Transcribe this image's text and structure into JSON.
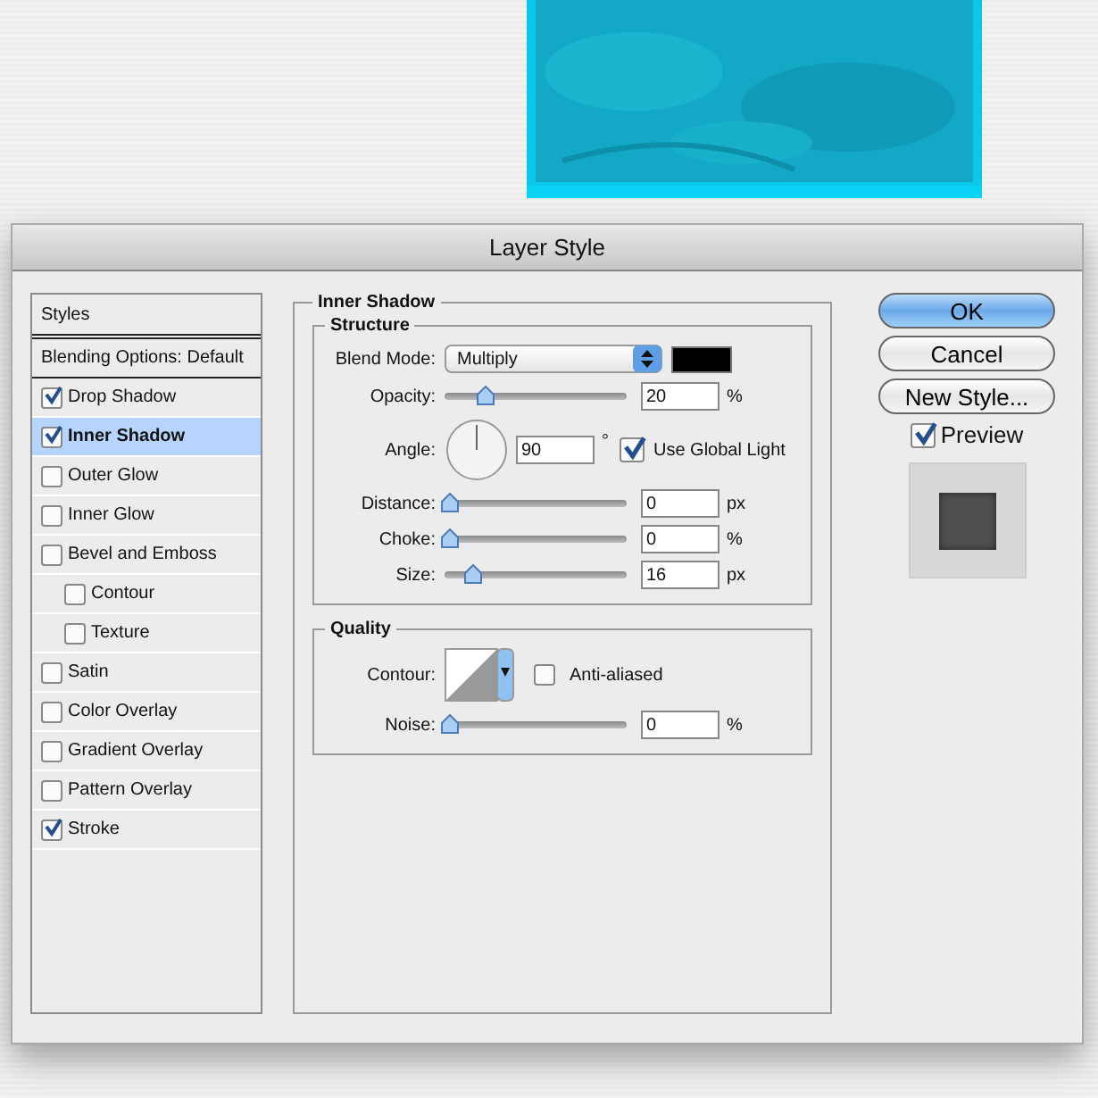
{
  "window": {
    "title": "Layer Style"
  },
  "styles_list": {
    "header": "Styles",
    "items": [
      {
        "kind": "plain",
        "label": "Blending Options: Default",
        "selected": false
      },
      {
        "kind": "check",
        "label": "Drop Shadow",
        "checked": true,
        "selected": false
      },
      {
        "kind": "check",
        "label": "Inner Shadow",
        "checked": true,
        "selected": true
      },
      {
        "kind": "check",
        "label": "Outer Glow",
        "checked": false,
        "selected": false
      },
      {
        "kind": "check",
        "label": "Inner Glow",
        "checked": false,
        "selected": false
      },
      {
        "kind": "check",
        "label": "Bevel and Emboss",
        "checked": false,
        "selected": false,
        "children": [
          {
            "kind": "check",
            "label": "Contour",
            "checked": false,
            "selected": false
          },
          {
            "kind": "check",
            "label": "Texture",
            "checked": false,
            "selected": false
          }
        ]
      },
      {
        "kind": "check",
        "label": "Satin",
        "checked": false,
        "selected": false
      },
      {
        "kind": "check",
        "label": "Color Overlay",
        "checked": false,
        "selected": false
      },
      {
        "kind": "check",
        "label": "Gradient Overlay",
        "checked": false,
        "selected": false
      },
      {
        "kind": "check",
        "label": "Pattern Overlay",
        "checked": false,
        "selected": false
      },
      {
        "kind": "check",
        "label": "Stroke",
        "checked": true,
        "selected": false
      }
    ]
  },
  "inner_shadow": {
    "title": "Inner Shadow",
    "structure": {
      "title": "Structure",
      "rows": [
        {
          "kind": "select",
          "label": "Blend Mode:",
          "value": "Multiply",
          "color": "#000000"
        },
        {
          "kind": "slider",
          "label": "Opacity:",
          "level": 0.2,
          "value": "20",
          "unit": "%"
        },
        {
          "kind": "angle",
          "label": "Angle:",
          "value": "90",
          "unit": "°",
          "global_light": {
            "label": "Use Global Light",
            "checked": true
          }
        },
        {
          "kind": "slider",
          "label": "Distance:",
          "level": 0,
          "value": "0",
          "unit": "px"
        },
        {
          "kind": "slider",
          "label": "Choke:",
          "level": 0,
          "value": "0",
          "unit": "%"
        },
        {
          "kind": "slider",
          "label": "Size:",
          "level": 0.13,
          "value": "16",
          "unit": "px"
        }
      ]
    },
    "quality": {
      "title": "Quality",
      "rows": [
        {
          "kind": "contour",
          "label": "Contour:",
          "anti_aliased": {
            "label": "Anti-aliased",
            "checked": false
          }
        },
        {
          "kind": "slider",
          "label": "Noise:",
          "level": 0,
          "value": "0",
          "unit": "%"
        }
      ]
    }
  },
  "buttons": [
    {
      "label": "OK",
      "default": true
    },
    {
      "label": "Cancel",
      "default": false
    },
    {
      "label": "New Style...",
      "default": false
    }
  ],
  "preview": {
    "label": "Preview",
    "checked": true
  }
}
